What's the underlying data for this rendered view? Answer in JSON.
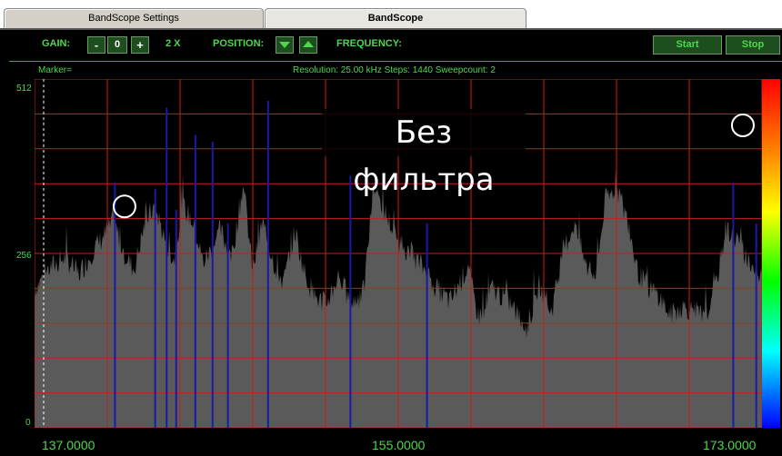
{
  "tabs": [
    {
      "label": "BandScope Settings",
      "active": false
    },
    {
      "label": "BandScope",
      "active": true
    }
  ],
  "toolbar": {
    "gain_label": "GAIN:",
    "gain_minus": "-",
    "gain_value": "0",
    "gain_plus": "+",
    "gain_multiplier": "2 X",
    "position_label": "POSITION:",
    "frequency_label": "FREQUENCY:",
    "start_label": "Start",
    "stop_label": "Stop"
  },
  "status": {
    "marker": "Marker=",
    "info": "Resolution: 25.00 kHz Steps: 1440 Sweepcount: 2"
  },
  "overlay_text": "Без фильтра",
  "colors": {
    "accent_green": "#4cd84c",
    "grid_red": "#c81e1e",
    "spectrum_gray": "#5a5a5a",
    "marker_blue": "#1a1aa8"
  },
  "chart_data": {
    "type": "area",
    "ylim": [
      0,
      512
    ],
    "yticks": [
      "512",
      "256",
      "0"
    ],
    "xlim": [
      137.0,
      175.0
    ],
    "xticks": [
      "137.0000",
      "155.0000",
      "173.0000"
    ],
    "grid": true,
    "anchors": [
      [
        137.0,
        205
      ],
      [
        137.8,
        235
      ],
      [
        138.6,
        250
      ],
      [
        139.3,
        225
      ],
      [
        140.1,
        262
      ],
      [
        140.7,
        285
      ],
      [
        141.1,
        305
      ],
      [
        141.7,
        255
      ],
      [
        142.2,
        232
      ],
      [
        142.8,
        305
      ],
      [
        143.3,
        325
      ],
      [
        143.8,
        278
      ],
      [
        144.3,
        246
      ],
      [
        144.7,
        330
      ],
      [
        145.3,
        300
      ],
      [
        145.8,
        243
      ],
      [
        146.2,
        260
      ],
      [
        146.7,
        290
      ],
      [
        147.3,
        250
      ],
      [
        147.9,
        358
      ],
      [
        148.4,
        230
      ],
      [
        148.9,
        302
      ],
      [
        149.5,
        242
      ],
      [
        150.0,
        212
      ],
      [
        150.6,
        290
      ],
      [
        151.1,
        228
      ],
      [
        151.6,
        195
      ],
      [
        152.2,
        180
      ],
      [
        152.9,
        225
      ],
      [
        153.5,
        180
      ],
      [
        154.2,
        200
      ],
      [
        154.7,
        355
      ],
      [
        155.3,
        318
      ],
      [
        155.9,
        278
      ],
      [
        156.7,
        255
      ],
      [
        157.4,
        232
      ],
      [
        158.0,
        205
      ],
      [
        158.7,
        185
      ],
      [
        159.6,
        235
      ],
      [
        160.2,
        162
      ],
      [
        160.9,
        205
      ],
      [
        161.8,
        185
      ],
      [
        162.7,
        145
      ],
      [
        163.4,
        210
      ],
      [
        164.0,
        170
      ],
      [
        164.6,
        258
      ],
      [
        165.2,
        300
      ],
      [
        165.8,
        238
      ],
      [
        166.3,
        222
      ],
      [
        166.8,
        330
      ],
      [
        167.4,
        355
      ],
      [
        168.0,
        302
      ],
      [
        168.5,
        228
      ],
      [
        169.1,
        205
      ],
      [
        169.6,
        195
      ],
      [
        170.2,
        165
      ],
      [
        170.8,
        178
      ],
      [
        171.4,
        172
      ],
      [
        172.0,
        160
      ],
      [
        172.6,
        210
      ],
      [
        173.1,
        292
      ],
      [
        173.7,
        278
      ],
      [
        174.3,
        245
      ],
      [
        175.0,
        215
      ]
    ],
    "markers_x": [
      141.2,
      143.3,
      143.9,
      144.4,
      145.4,
      146.3,
      147.1,
      149.2,
      153.5,
      157.5,
      173.5,
      174.7
    ],
    "marker_levels": [
      360,
      350,
      470,
      320,
      430,
      420,
      300,
      480,
      370,
      300,
      360,
      300
    ],
    "circled_peaks": [
      [
        141.7,
        255
      ],
      [
        174.0,
        374
      ]
    ]
  }
}
